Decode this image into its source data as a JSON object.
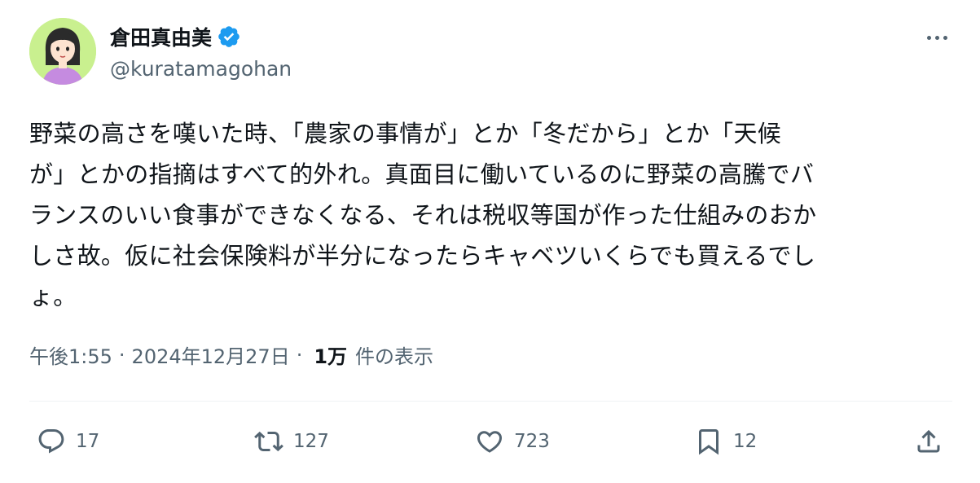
{
  "tweet": {
    "author": {
      "display_name": "倉田真由美",
      "handle": "@kuratamagohan",
      "verified": true
    },
    "text": "野菜の高さを嘆いた時、「農家の事情が」とか「冬だから」とか「天候\nが」とかの指摘はすべて的外れ。真面目に働いているのに野菜の高騰でバ\nランスのいい食事ができなくなる、それは税収等国が作った仕組みのおか\nしさ故。仮に社会保険料が半分になったらキャベツいくらでも買えるでし\nょ。",
    "time": "午後1:55",
    "separator": "·",
    "date": "2024年12月27日",
    "views_count": "1万",
    "views_label": "件の表示"
  },
  "actions": {
    "reply_count": "17",
    "retweet_count": "127",
    "like_count": "723",
    "bookmark_count": "12"
  },
  "icons": {
    "avatar": "avatar-illustration",
    "verified": "verified-badge-icon",
    "more": "more-options-icon",
    "reply": "reply-icon",
    "retweet": "retweet-icon",
    "like": "heart-icon",
    "bookmark": "bookmark-icon",
    "share": "share-icon"
  },
  "colors": {
    "text": "#0f1419",
    "secondary": "#536471",
    "verified": "#1d9bf0",
    "avatar_bg": "#c9f08f"
  }
}
